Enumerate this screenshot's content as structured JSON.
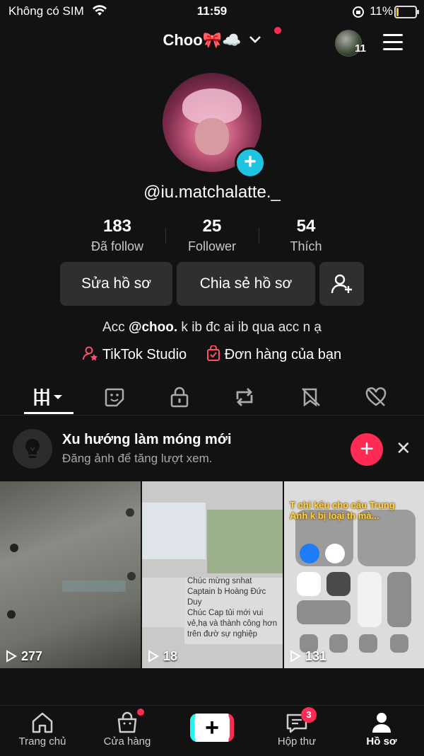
{
  "status_bar": {
    "carrier": "Không có SIM",
    "time": "11:59",
    "battery": "11%"
  },
  "header": {
    "username": "Choo🎀☁️",
    "notif_count": "11"
  },
  "profile": {
    "handle": "@iu.matchalatte._",
    "stats": [
      {
        "value": "183",
        "label": "Đã follow"
      },
      {
        "value": "25",
        "label": "Follower"
      },
      {
        "value": "54",
        "label": "Thích"
      }
    ],
    "edit_button": "Sửa hồ sơ",
    "share_button": "Chia sẻ hồ sơ",
    "bio_prefix": "Acc ",
    "bio_mention": "@choo.",
    "bio_suffix": " k ib đc ai ib qua acc n ạ",
    "studio_link": "TikTok Studio",
    "orders_link": "Đơn hàng của bạn"
  },
  "banner": {
    "title": "Xu hướng làm móng mới",
    "subtitle": "Đăng ảnh để tăng lượt xem."
  },
  "videos": [
    {
      "views": "277"
    },
    {
      "views": "18",
      "text1": "Chúc mừng snhat Captain b Hoàng Đức Duy",
      "text2": "Chúc Cap tủi mới vui vẻ,hạ và thành công hơn trên đườ sự nghiệp"
    },
    {
      "views": "131",
      "caption": "T chỉ kêu cho cậu Trung Anh k bị loại th mà..."
    }
  ],
  "nav": [
    {
      "label": "Trang chủ"
    },
    {
      "label": "Cửa hàng"
    },
    {
      "label": "Hộp thư",
      "badge": "3"
    },
    {
      "label": "Hồ sơ"
    }
  ],
  "colors": {
    "accent": "#ff2b55",
    "teal": "#20c4e2",
    "background": "#121212",
    "button": "#2f2f2f"
  }
}
